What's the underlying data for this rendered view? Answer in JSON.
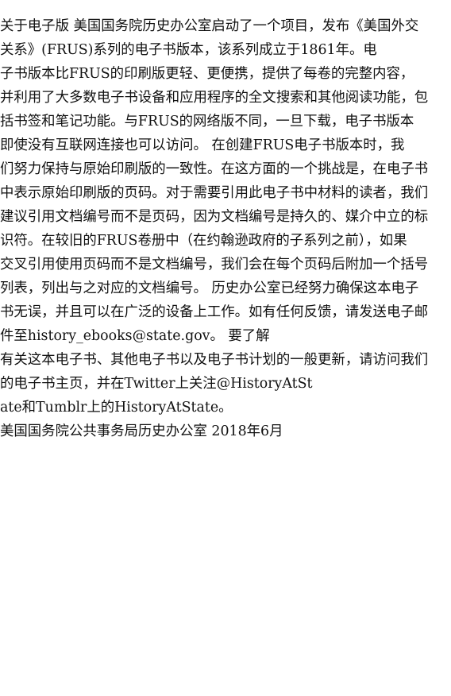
{
  "document": {
    "lines": [
      "关于电子版 美国国务院历史办公室启动了一个项目，发布《美国外交",
      "关系》(FRUS)系列的电子书版本，该系列成立于1861年。电",
      "子书版本比FRUS的印刷版更轻、更便携，提供了每卷的完整内容，",
      "并利用了大多数电子书设备和应用程序的全文搜索和其他阅读功能，包",
      "括书签和笔记功能。与FRUS的网络版不同，一旦下载，电子书版本",
      "即使没有互联网连接也可以访问。 在创建FRUS电子书版本时，我",
      "们努力保持与原始印刷版的一致性。在这方面的一个挑战是，在电子书",
      "中表示原始印刷版的页码。对于需要引用此电子书中材料的读者，我们",
      "建议引用文档编号而不是页码，因为文档编号是持久的、媒介中立的标",
      "识符。在较旧的FRUS卷册中（在约翰逊政府的子系列之前），如果",
      "交叉引用使用页码而不是文档编号，我们会在每个页码后附加一个括号",
      "列表，列出与之对应的文档编号。 历史办公室已经努力确保这本电子",
      "书无误，并且可以在广泛的设备上工作。如有任何反馈，请发送电子邮",
      "件至history_ebooks@state.gov。 要了解",
      "有关这本电子书、其他电子书以及电子书计划的一般更新，请访问我们",
      "的电子书主页，并在Twitter上关注@HistoryAtSt",
      "ate和Tumblr上的HistoryAtState。",
      "美国国务院公共事务局历史办公室 2018年6月"
    ]
  }
}
